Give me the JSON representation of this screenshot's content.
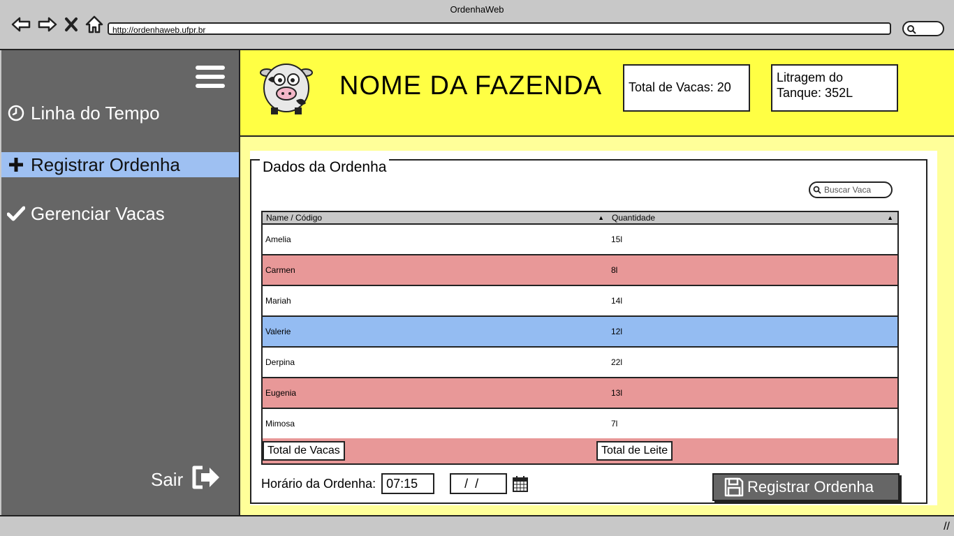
{
  "browser": {
    "title": "OrdenhaWeb",
    "url": "http://ordenhaweb.ufpr.br"
  },
  "sidebar": {
    "items": [
      {
        "label": "Linha do Tempo",
        "icon": "clock-icon",
        "active": false
      },
      {
        "label": "Registrar Ordenha",
        "icon": "plus-icon",
        "active": true
      },
      {
        "label": "Gerenciar Vacas",
        "icon": "check-icon",
        "active": false
      }
    ],
    "logout_label": "Sair"
  },
  "header": {
    "farm_name": "NOME DA FAZENDA",
    "total_vacas": "Total de Vacas: 20",
    "litragem_line1": "Litragem do",
    "litragem_line2": "Tanque: 352L"
  },
  "panel": {
    "legend": "Dados da Ordenha",
    "search_placeholder": "Buscar Vaca",
    "table": {
      "col_name": "Name / Código",
      "col_quantidade": "Quantidade",
      "rows": [
        {
          "name": "Amelia",
          "qty": "15l"
        },
        {
          "name": "Carmen",
          "qty": "8l"
        },
        {
          "name": "Mariah",
          "qty": "14l"
        },
        {
          "name": "Valerie",
          "qty": "12l"
        },
        {
          "name": "Derpina",
          "qty": "22l"
        },
        {
          "name": "Eugenia",
          "qty": "13l"
        },
        {
          "name": "Mimosa",
          "qty": "7l"
        }
      ],
      "total_vacas_label": "Total de Vacas",
      "total_leite_label": "Total de Leite"
    },
    "horario_label": "Horário da Ordenha:",
    "horario_value": "07:15",
    "date_value": " /  /",
    "register_button": "Registrar Ordenha"
  },
  "colors": {
    "header_bg": "#ffff44",
    "content_bg": "#ffff99",
    "sidebar_bg": "#666666",
    "sidebar_active": "#9ec0f2",
    "row_red": "#e89898",
    "row_blue": "#94bcf2"
  }
}
